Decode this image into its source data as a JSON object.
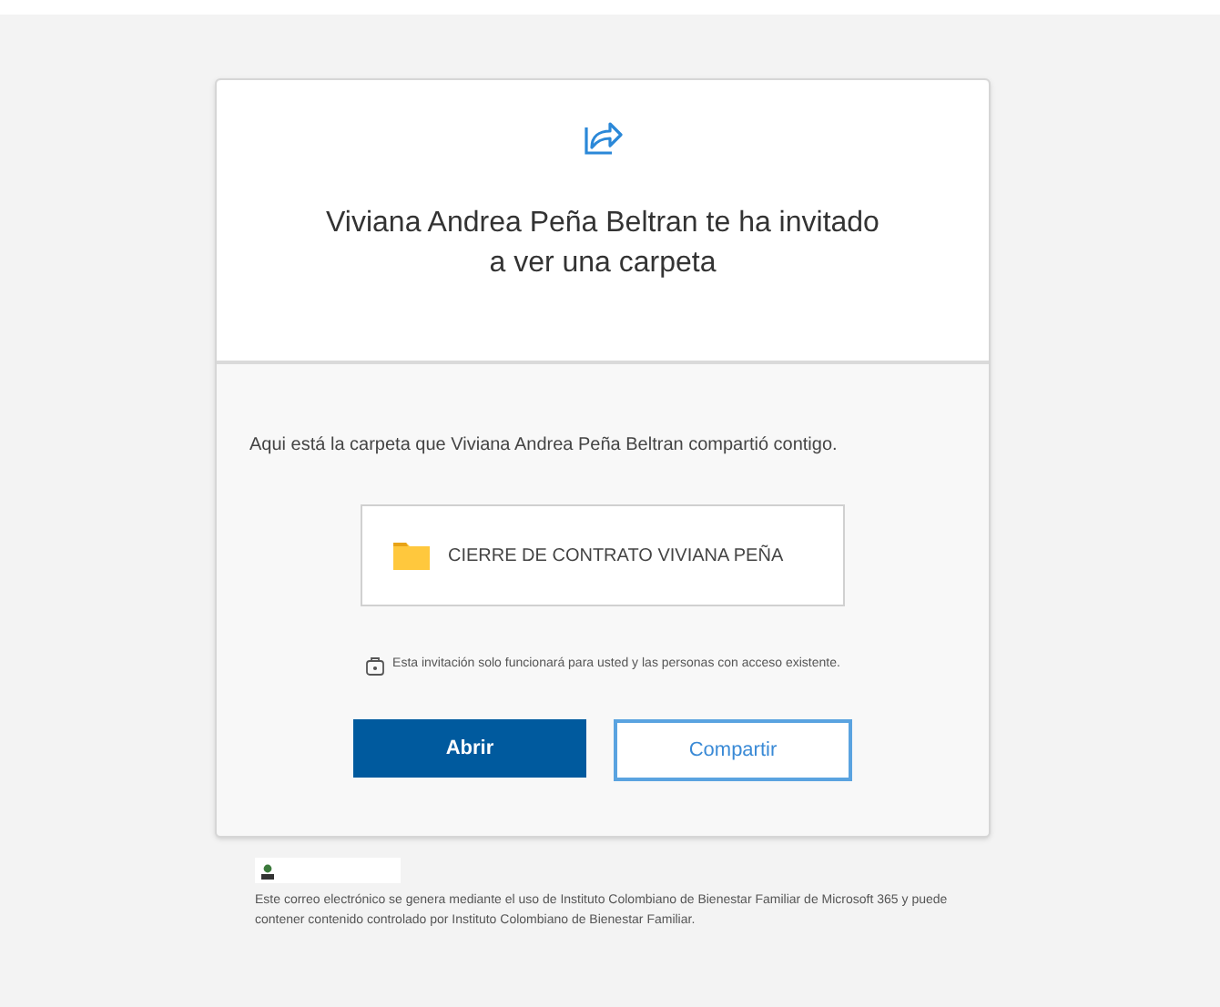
{
  "header": {
    "title": "Viviana Andrea Peña Beltran te ha invitado a ver una carpeta"
  },
  "message": "Aqui está la carpeta que Viviana Andrea Peña Beltran compartió contigo.",
  "folder": {
    "name": "CIERRE DE CONTRATO VIVIANA PEÑA"
  },
  "notice": "Esta invitación solo funcionará para usted y las personas con acceso existente.",
  "buttons": [
    {
      "label": "Abrir",
      "kind": "primary"
    },
    {
      "label": "Compartir",
      "kind": "secondary"
    }
  ],
  "footer": {
    "text": "Este correo electrónico se genera mediante el uso de Instituto Colombiano de Bienestar Familiar de Microsoft 365 y puede contener contenido controlado por Instituto Colombiano de Bienestar Familiar."
  }
}
